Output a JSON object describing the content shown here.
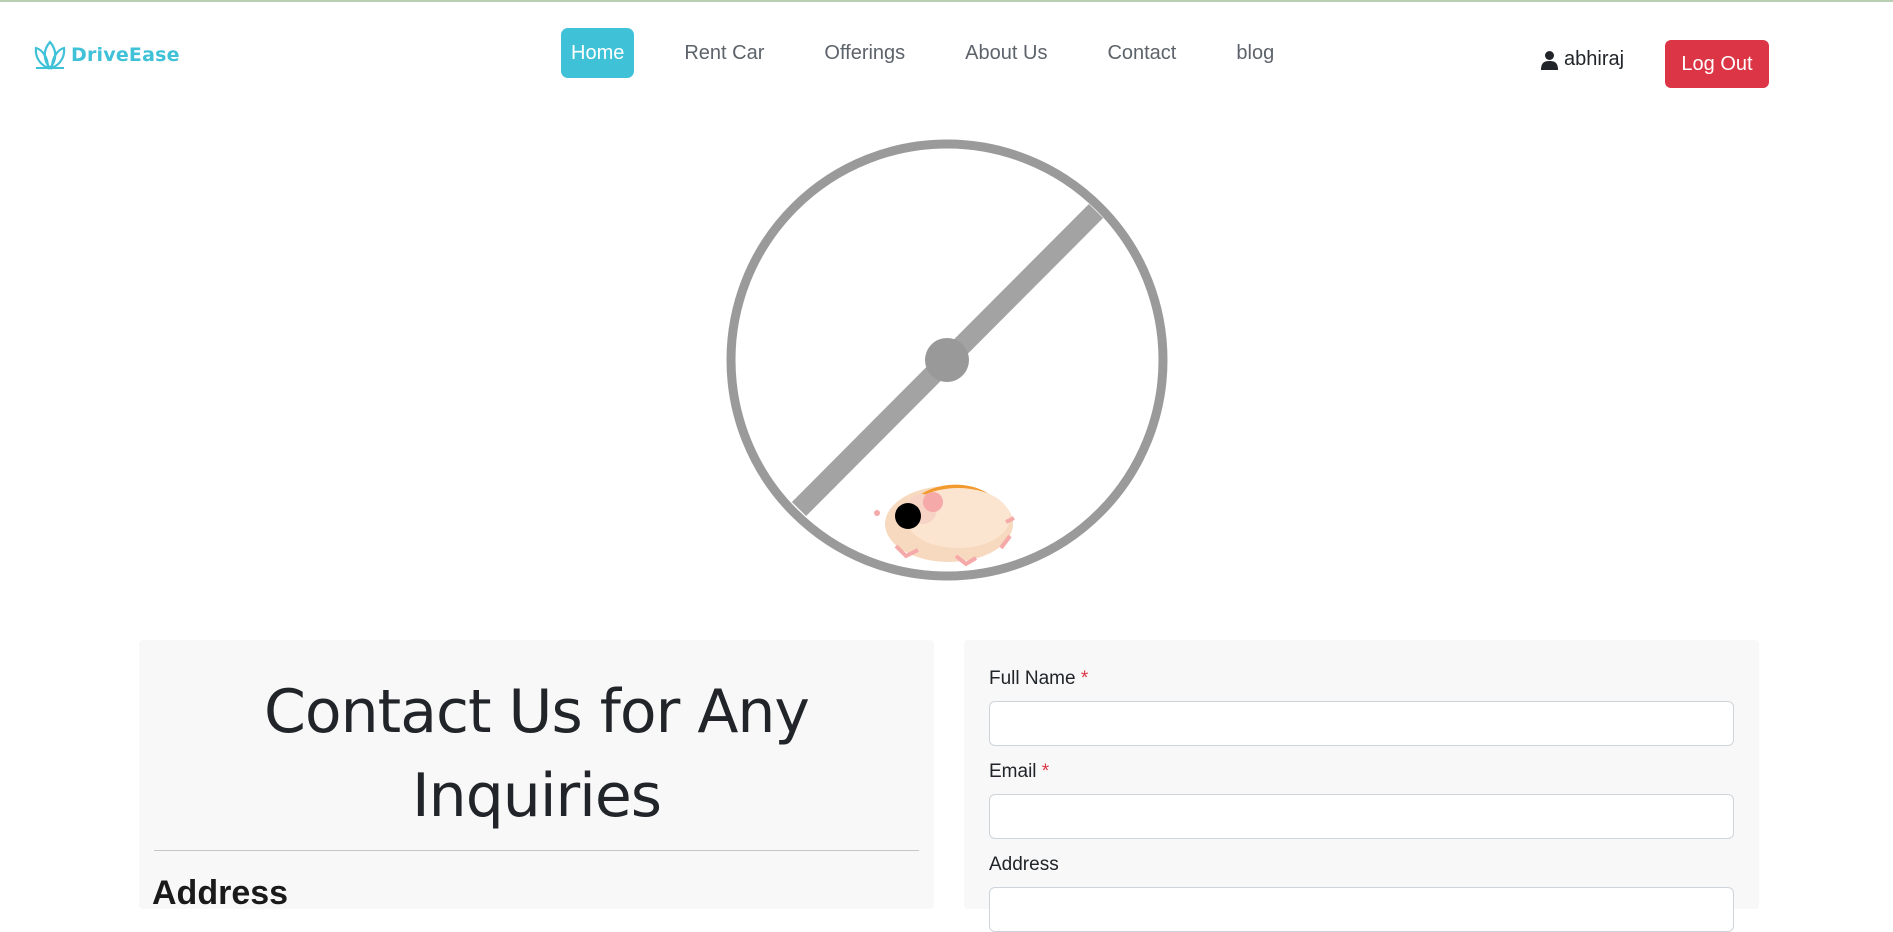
{
  "brand": {
    "name": "DriveEase",
    "accent_color": "#3fc1d8"
  },
  "nav": {
    "items": [
      {
        "label": "Home",
        "active": true
      },
      {
        "label": "Rent Car",
        "active": false
      },
      {
        "label": "Offerings",
        "active": false
      },
      {
        "label": "About Us",
        "active": false
      },
      {
        "label": "Contact",
        "active": false
      },
      {
        "label": "blog",
        "active": false
      }
    ],
    "user": {
      "icon": "user-icon",
      "name": "abhiraj"
    },
    "logout_label": "Log Out",
    "logout_color": "#dc3545"
  },
  "loader": {
    "icon": "hamster-wheel-icon"
  },
  "contact": {
    "title_line1": "Contact Us for Any",
    "title_line2": "Inquiries",
    "address_heading": "Address"
  },
  "form": {
    "full_name_label": "Full Name",
    "email_label": "Email",
    "address_label": "Address",
    "required_marker": "*",
    "full_name_value": "",
    "email_value": "",
    "address_value": ""
  }
}
